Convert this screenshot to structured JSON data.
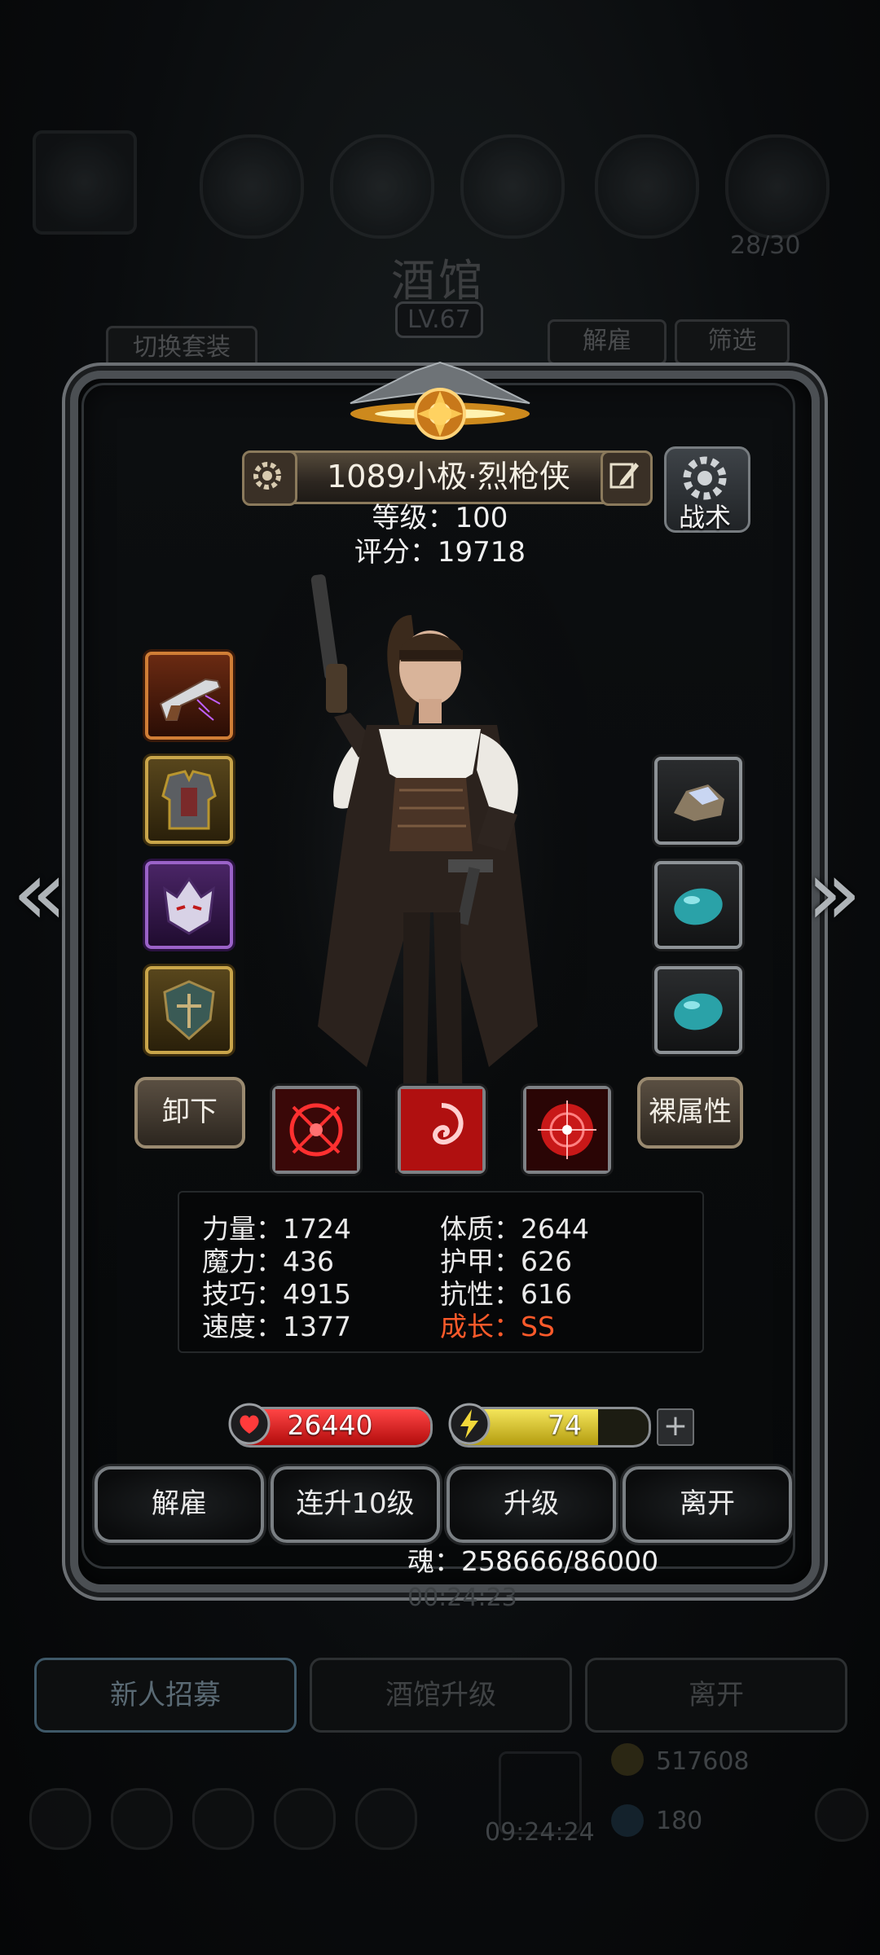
{
  "background": {
    "title": "酒馆",
    "level": "LV.67",
    "switch_set_label": "切换套装",
    "dismiss_label": "解雇",
    "filter_label": "筛选",
    "timer_top": "00:24:23",
    "bottom_buttons": [
      "新人招募",
      "酒馆升级",
      "离开"
    ],
    "timer_bottom": "09:24:24",
    "counter_partial": "28/30",
    "gold": "517608",
    "gems": "180"
  },
  "hero": {
    "name": "1089小极·烈枪侠",
    "level_line": "等级：100",
    "score_line": "评分：19718",
    "tactic_label": "战术"
  },
  "equipment": {
    "left": [
      "pistol-weapon",
      "chest-armor",
      "demon-helmet",
      "shield-emblem"
    ],
    "right": [
      "crystal-stone",
      "turquoise-gem",
      "turquoise-gem"
    ]
  },
  "buttons": {
    "unequip": "卸下",
    "bare_attributes": "裸属性"
  },
  "skills": [
    "crosshair-skill",
    "swirl-skill",
    "target-skill"
  ],
  "stats": {
    "left": [
      "力量：1724",
      "魔力：436",
      "技巧：4915",
      "速度：1377"
    ],
    "right": [
      "体质：2644",
      "护甲：626",
      "抗性：616"
    ],
    "growth": "成长：SS"
  },
  "hp": {
    "value": "26440",
    "fill": 1.0,
    "color": "#e02020"
  },
  "energy": {
    "value": "74",
    "fill": 0.74,
    "color": "#e8d630"
  },
  "plus_label": "+",
  "actions": [
    "解雇",
    "连升10级",
    "升级",
    "离开"
  ],
  "soul_line": "魂：258666/86000"
}
